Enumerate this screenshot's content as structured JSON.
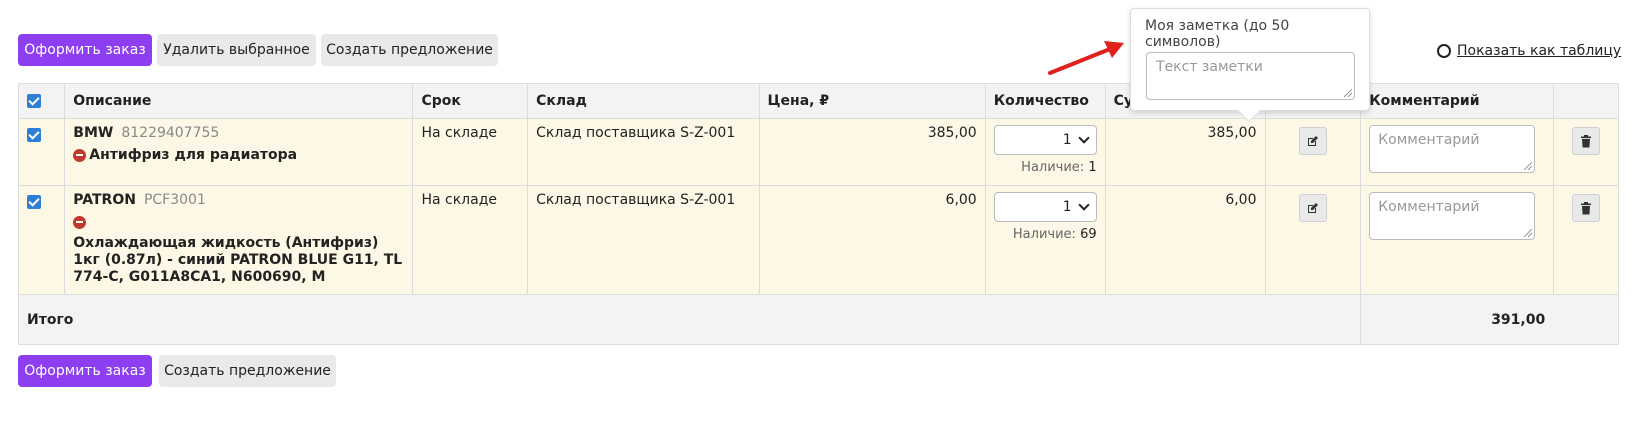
{
  "toolbar": {
    "order_label": "Оформить заказ",
    "delete_label": "Удалить выбранное",
    "offer_label": "Создать предложение",
    "view_table_label": "Показать как таблицу"
  },
  "table": {
    "headers": {
      "description": "Описание",
      "term": "Срок",
      "warehouse": "Склад",
      "price": "Цена, ₽",
      "quantity": "Количество",
      "sum": "Сумма, ₽",
      "comment": "Комментарий"
    },
    "rows": [
      {
        "brand": "BMW",
        "article": "81229407755",
        "name": "Антифриз для радиатора",
        "term": "На складе",
        "warehouse": "Склад поставщика S-Z-001",
        "price": "385,00",
        "qty": "1",
        "stock_label": "Наличие:",
        "stock_value": "1",
        "sum": "385,00",
        "comment_placeholder": "Комментарий"
      },
      {
        "brand": "PATRON",
        "article": "PCF3001",
        "name": "Охлаждающая жидкость (Антифриз) 1кг (0.87л) - синий PATRON BLUE G11, TL 774-C, G011A8CA1, N600690, M",
        "term": "На складе",
        "warehouse": "Склад поставщика S-Z-001",
        "price": "6,00",
        "qty": "1",
        "stock_label": "Наличие:",
        "stock_value": "69",
        "sum": "6,00",
        "comment_placeholder": "Комментарий"
      }
    ],
    "total_label": "Итого",
    "total_value": "391,00"
  },
  "bottom": {
    "order_label": "Оформить заказ",
    "offer_label": "Создать предложение"
  },
  "note_popover": {
    "title": "Моя заметка (до 50 символов)",
    "placeholder": "Текст заметки"
  },
  "colors": {
    "primary": "#8d3ef0",
    "row_bg": "#fdf8e6",
    "header_bg": "#f3f3f3",
    "checkbox": "#2f7fd6",
    "stop": "#c0392b",
    "arrow": "#e0201c"
  }
}
